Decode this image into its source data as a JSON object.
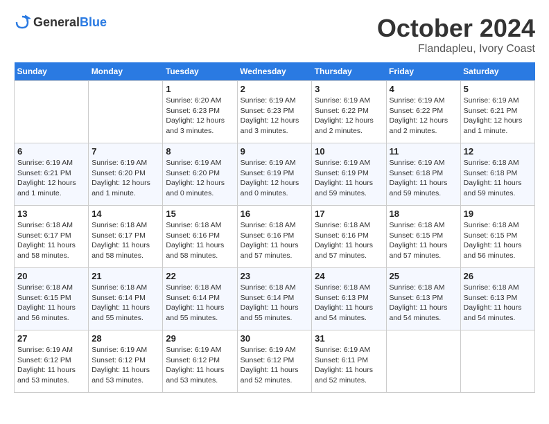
{
  "header": {
    "logo_general": "General",
    "logo_blue": "Blue",
    "month": "October 2024",
    "location": "Flandapleu, Ivory Coast"
  },
  "weekdays": [
    "Sunday",
    "Monday",
    "Tuesday",
    "Wednesday",
    "Thursday",
    "Friday",
    "Saturday"
  ],
  "weeks": [
    [
      {
        "day": "",
        "info": ""
      },
      {
        "day": "",
        "info": ""
      },
      {
        "day": "1",
        "info": "Sunrise: 6:20 AM\nSunset: 6:23 PM\nDaylight: 12 hours and 3 minutes."
      },
      {
        "day": "2",
        "info": "Sunrise: 6:19 AM\nSunset: 6:23 PM\nDaylight: 12 hours and 3 minutes."
      },
      {
        "day": "3",
        "info": "Sunrise: 6:19 AM\nSunset: 6:22 PM\nDaylight: 12 hours and 2 minutes."
      },
      {
        "day": "4",
        "info": "Sunrise: 6:19 AM\nSunset: 6:22 PM\nDaylight: 12 hours and 2 minutes."
      },
      {
        "day": "5",
        "info": "Sunrise: 6:19 AM\nSunset: 6:21 PM\nDaylight: 12 hours and 1 minute."
      }
    ],
    [
      {
        "day": "6",
        "info": "Sunrise: 6:19 AM\nSunset: 6:21 PM\nDaylight: 12 hours and 1 minute."
      },
      {
        "day": "7",
        "info": "Sunrise: 6:19 AM\nSunset: 6:20 PM\nDaylight: 12 hours and 1 minute."
      },
      {
        "day": "8",
        "info": "Sunrise: 6:19 AM\nSunset: 6:20 PM\nDaylight: 12 hours and 0 minutes."
      },
      {
        "day": "9",
        "info": "Sunrise: 6:19 AM\nSunset: 6:19 PM\nDaylight: 12 hours and 0 minutes."
      },
      {
        "day": "10",
        "info": "Sunrise: 6:19 AM\nSunset: 6:19 PM\nDaylight: 11 hours and 59 minutes."
      },
      {
        "day": "11",
        "info": "Sunrise: 6:19 AM\nSunset: 6:18 PM\nDaylight: 11 hours and 59 minutes."
      },
      {
        "day": "12",
        "info": "Sunrise: 6:18 AM\nSunset: 6:18 PM\nDaylight: 11 hours and 59 minutes."
      }
    ],
    [
      {
        "day": "13",
        "info": "Sunrise: 6:18 AM\nSunset: 6:17 PM\nDaylight: 11 hours and 58 minutes."
      },
      {
        "day": "14",
        "info": "Sunrise: 6:18 AM\nSunset: 6:17 PM\nDaylight: 11 hours and 58 minutes."
      },
      {
        "day": "15",
        "info": "Sunrise: 6:18 AM\nSunset: 6:16 PM\nDaylight: 11 hours and 58 minutes."
      },
      {
        "day": "16",
        "info": "Sunrise: 6:18 AM\nSunset: 6:16 PM\nDaylight: 11 hours and 57 minutes."
      },
      {
        "day": "17",
        "info": "Sunrise: 6:18 AM\nSunset: 6:16 PM\nDaylight: 11 hours and 57 minutes."
      },
      {
        "day": "18",
        "info": "Sunrise: 6:18 AM\nSunset: 6:15 PM\nDaylight: 11 hours and 57 minutes."
      },
      {
        "day": "19",
        "info": "Sunrise: 6:18 AM\nSunset: 6:15 PM\nDaylight: 11 hours and 56 minutes."
      }
    ],
    [
      {
        "day": "20",
        "info": "Sunrise: 6:18 AM\nSunset: 6:15 PM\nDaylight: 11 hours and 56 minutes."
      },
      {
        "day": "21",
        "info": "Sunrise: 6:18 AM\nSunset: 6:14 PM\nDaylight: 11 hours and 55 minutes."
      },
      {
        "day": "22",
        "info": "Sunrise: 6:18 AM\nSunset: 6:14 PM\nDaylight: 11 hours and 55 minutes."
      },
      {
        "day": "23",
        "info": "Sunrise: 6:18 AM\nSunset: 6:14 PM\nDaylight: 11 hours and 55 minutes."
      },
      {
        "day": "24",
        "info": "Sunrise: 6:18 AM\nSunset: 6:13 PM\nDaylight: 11 hours and 54 minutes."
      },
      {
        "day": "25",
        "info": "Sunrise: 6:18 AM\nSunset: 6:13 PM\nDaylight: 11 hours and 54 minutes."
      },
      {
        "day": "26",
        "info": "Sunrise: 6:18 AM\nSunset: 6:13 PM\nDaylight: 11 hours and 54 minutes."
      }
    ],
    [
      {
        "day": "27",
        "info": "Sunrise: 6:19 AM\nSunset: 6:12 PM\nDaylight: 11 hours and 53 minutes."
      },
      {
        "day": "28",
        "info": "Sunrise: 6:19 AM\nSunset: 6:12 PM\nDaylight: 11 hours and 53 minutes."
      },
      {
        "day": "29",
        "info": "Sunrise: 6:19 AM\nSunset: 6:12 PM\nDaylight: 11 hours and 53 minutes."
      },
      {
        "day": "30",
        "info": "Sunrise: 6:19 AM\nSunset: 6:12 PM\nDaylight: 11 hours and 52 minutes."
      },
      {
        "day": "31",
        "info": "Sunrise: 6:19 AM\nSunset: 6:11 PM\nDaylight: 11 hours and 52 minutes."
      },
      {
        "day": "",
        "info": ""
      },
      {
        "day": "",
        "info": ""
      }
    ]
  ]
}
